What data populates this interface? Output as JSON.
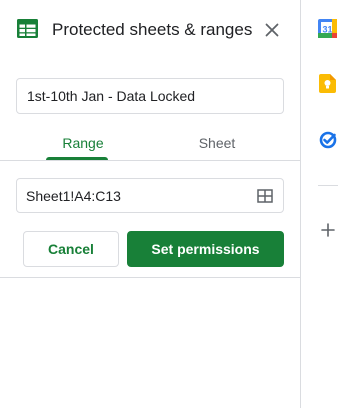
{
  "header": {
    "title": "Protected sheets & ranges",
    "icon": "sheets-icon",
    "close_icon": "close-icon"
  },
  "description": {
    "value": "1st-10th Jan - Data Locked"
  },
  "tabs": [
    {
      "label": "Range",
      "active": true
    },
    {
      "label": "Sheet",
      "active": false
    }
  ],
  "range": {
    "value": "Sheet1!A4:C13",
    "icon": "grid-icon"
  },
  "actions": {
    "cancel_label": "Cancel",
    "set_permissions_label": "Set permissions"
  },
  "side_rail": {
    "icons": [
      "calendar-icon",
      "keep-icon",
      "tasks-icon",
      "plus-icon"
    ]
  },
  "colors": {
    "accent": "#188038",
    "divider": "#dadce0",
    "calendar_blue": "#4285f4",
    "keep_yellow": "#fbbc04",
    "tasks_blue": "#1a73e8"
  }
}
